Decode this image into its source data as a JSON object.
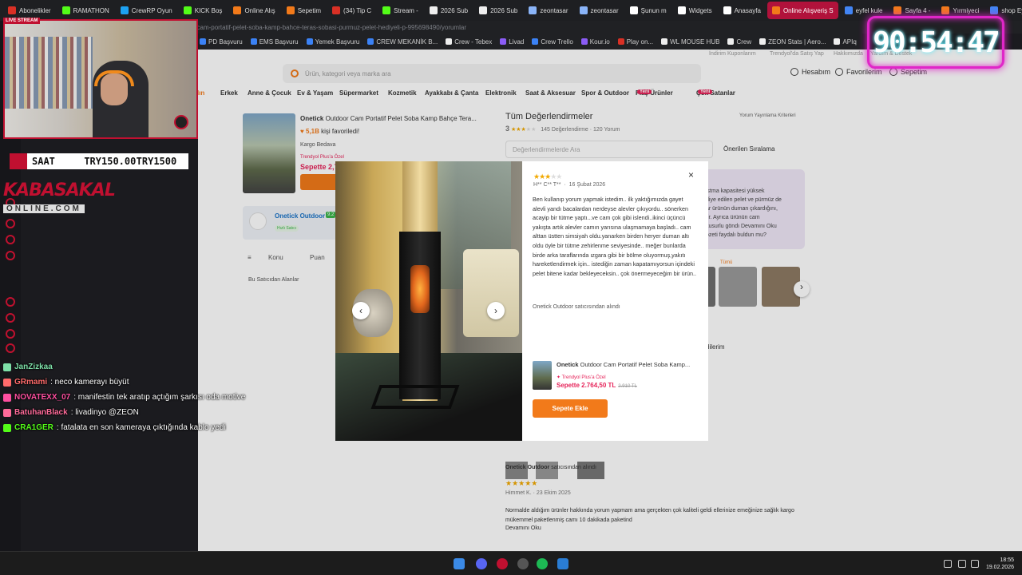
{
  "browser": {
    "tabs": [
      {
        "label": "Abonelikler",
        "color": "#d93025"
      },
      {
        "label": "RAMATHON",
        "color": "#53fc18"
      },
      {
        "label": "CrewRP Oyun",
        "color": "#1da1f2"
      },
      {
        "label": "KICK Boş",
        "color": "#53fc18"
      },
      {
        "label": "Online Alış",
        "color": "#f27a1a"
      },
      {
        "label": "Sepetim",
        "color": "#f27a1a"
      },
      {
        "label": "(34) Tip C",
        "color": "#d93025"
      },
      {
        "label": "Stream -",
        "color": "#53fc18"
      },
      {
        "label": "2026 Sub",
        "color": "#eee"
      },
      {
        "label": "2026 Sub",
        "color": "#eee"
      },
      {
        "label": "zeontasar",
        "color": "#8ab4f8"
      },
      {
        "label": "zeontasar",
        "color": "#8ab4f8"
      },
      {
        "label": "Şunun m",
        "color": "#fff"
      },
      {
        "label": "Widgets",
        "color": "#fff"
      },
      {
        "label": "Anasayfa",
        "color": "#fff"
      },
      {
        "label": "Online Alışveriş S",
        "color": "#f27a1a",
        "active": true
      },
      {
        "label": "eyfel kule",
        "color": "#4285f4"
      },
      {
        "label": "Sayfa 4 -",
        "color": "#f27a1a"
      },
      {
        "label": "Yırmiyeci",
        "color": "#f27a1a"
      },
      {
        "label": "shop Eyfel",
        "color": "#4285f4"
      }
    ],
    "url": "www.trendyol.com/onetick/outdoor-cam-portatif-pelet-soba-kamp-bahce-teras-sobasi-purmuz-pelet-hediyeli-p-995698490/yorumlar",
    "bookmarks": [
      {
        "label": "PD Başvuru",
        "color": "#3b82f6"
      },
      {
        "label": "EMS Başvuru",
        "color": "#3b82f6"
      },
      {
        "label": "Yemek Başvuru",
        "color": "#3b82f6"
      },
      {
        "label": "CREW MEKANİK B...",
        "color": "#3b82f6"
      },
      {
        "label": "Crew - Tebex",
        "color": "#eee"
      },
      {
        "label": "Livad",
        "color": "#8b5cf6"
      },
      {
        "label": "Crew Trello",
        "color": "#3b82f6"
      },
      {
        "label": "Kour.io",
        "color": "#8b5cf6"
      },
      {
        "label": "Play on...",
        "color": "#d93025"
      },
      {
        "label": "WL MOUSE HUB",
        "color": "#eee"
      },
      {
        "label": "Crew",
        "color": "#eee"
      },
      {
        "label": "ZEON Stats | Aero...",
        "color": "#eee"
      },
      {
        "label": "APIq",
        "color": "#eee"
      }
    ]
  },
  "stream": {
    "live_tag": "LIVE STREAM",
    "ticker": {
      "label": "SAAT",
      "v1": "TRY150.00",
      "v2": "TRY1500"
    },
    "logo_line1": "KABASAKAL",
    "logo_line2": "ONLINE.COM",
    "timer": "90:54:47",
    "chat": [
      {
        "user": "JanZizkaa",
        "text": "",
        "color": "#7ee0a8"
      },
      {
        "user": "GRmami",
        "text": ": neco kamerayı büyüt",
        "color": "#ff6b6b"
      },
      {
        "user": "NOVATEXX_07",
        "text": ": manifestin tek aratıp açtığım şarkısı oda motive",
        "color": "#ff4fa0"
      },
      {
        "user": "BatuhanBlack",
        "text": ": livadinyo @ZEON",
        "color": "#ff6b9a"
      },
      {
        "user": "CRA1GER",
        "text": ": fatalata en son kameraya çıktığında kablo yedi",
        "color": "#53fc18"
      }
    ]
  },
  "site": {
    "toplinks": [
      "İndirim Kuponlarım",
      "Trendyol'da Satış Yap",
      "Hakkımızda",
      "Yardım & Destek"
    ],
    "search_placeholder": "Ürün, kategori veya marka ara",
    "account": "Hesabım",
    "favorites": "Favorilerim",
    "cart": "Sepetim",
    "nav": [
      "Kadın",
      "Erkek",
      "Anne & Çocuk",
      "Ev & Yaşam",
      "Süpermarket",
      "Kozmetik",
      "Ayakkabı & Çanta",
      "Elektronik",
      "Saat & Aksesuar",
      "Spor & Outdoor",
      "Flaş Ürünler",
      "Çok Satanlar"
    ],
    "yeni": "Yeni",
    "product": {
      "brand": "Onetick",
      "title": "Outdoor Cam Portatif Pelet Soba Kamp Bahçe Tera...",
      "fav_count": "5,1B",
      "fav_text": "kişi favoriledi!",
      "shipping": "Kargo Bedava",
      "plus": "Trendyol Plus'a Özel",
      "price": "Sepette 2,7..."
    },
    "seller": {
      "name": "Onetick Outdoor",
      "score": "9.2",
      "badge": "Hızlı Satıcı"
    },
    "filters": [
      "Konu",
      "Puan"
    ],
    "seller_questions": "Bu Satıcıdan Alanlar",
    "reviews": {
      "title": "Tüm Değerlendirmeler",
      "rating": "3",
      "count_text": "145 Değerlendirme",
      "comments_text": "120 Yorum",
      "criteria": "Yorum Yayınlama Kriterleri",
      "search_placeholder": "Değerlendirmelerde Ara",
      "sort": "Önerilen Sıralama",
      "all": "Tümü",
      "side_text": [
        "istma kapasitesi yüksek",
        "diye edilen pelet ve pürmüz de",
        "ar ürünün duman çıkardığını,",
        "tir. Ayrıca ürünün cam",
        "kusurlu göndı   Devamını Oku",
        "özeti faydalı buldun mu?"
      ],
      "discount_text": "dilerim",
      "review2_seller_brand": "Onetick Outdoor",
      "review2_seller": "satıcısından alındı",
      "review2_stars": 5,
      "review2_author": "Himmet K.",
      "review2_date": "23 Ekim 2025",
      "review2_text": "Normalde aldığım ürünler hakkında yorum yapmam ama gerçekten çok kaliteli geldi ellerinize emeğinize sağlık kargo mükemmel paketlenmiş camı 10 dakikada paketind",
      "more": "Devamını Oku"
    }
  },
  "modal": {
    "stars": 3,
    "author": "H** C** T**",
    "date": "16 Şubat 2026",
    "text": "Ben kullanıp yorum yapmak istedim.. ilk yaktığımızda gayet alevli yandı bacalardan nerdeyse alevler çıkıyordu.. sönerken acayip bir tütme yaptı...ve cam çok gibi islendi..ikinci üçüncü yakışta artık alevler camın yarısına ulaşmamaya başladı.. cam alttan üstten simsiyah oldu.yanarken birden heryer duman altı oldu öyle bir tütme zehirlenme seviyesinde.. meğer bunlarda birde arka taraflarında ızgara gibi bir bölme oluyormuş,yakıtı hareketlendirmek için.. istediğin zaman kapatamıyorsun içindeki pelet bitene kadar bekleyeceksin.. çok önermeyeceğim bir ürün..",
    "seller_brand": "Onetick Outdoor",
    "seller": "satıcısından alındı",
    "product_brand": "Onetick",
    "product_title": "Outdoor Cam Portatif Pelet Soba Kamp...",
    "plus": "Trendyol Plus'a Özel",
    "price": "Sepette 2.764,50 TL",
    "old_price": "2.910 TL",
    "add_to_cart": "Sepete Ekle",
    "close": "×",
    "prev": "‹",
    "next": "›"
  },
  "taskbar": {
    "time": "18:55",
    "date": "19.02.2026"
  }
}
